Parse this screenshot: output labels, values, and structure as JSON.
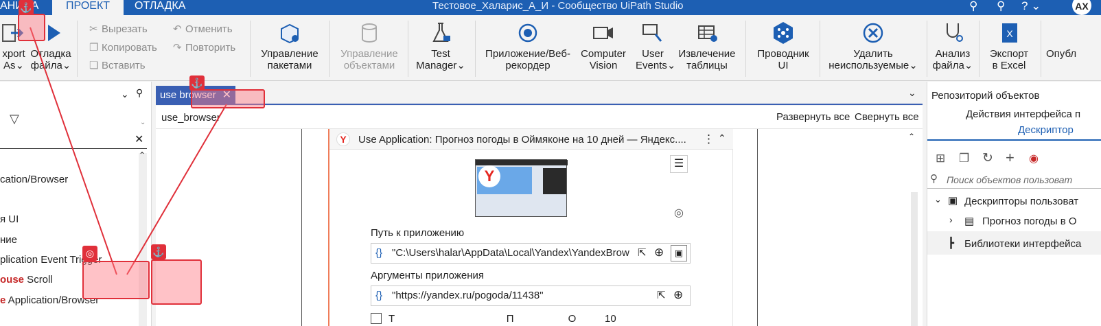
{
  "titlebar": {
    "tabs": [
      "АНИЦА",
      "ПРОЕКТ",
      "ОТЛАДКА"
    ],
    "window_title": "Тестовое_Халарис_А_И - Сообщество UiPath Studio",
    "avatar": "AX",
    "icons": [
      "search-icon",
      "account-icon",
      "help-icon"
    ]
  },
  "ribbon": {
    "export_as": [
      "xport",
      "As"
    ],
    "debug_file": [
      "Отладка",
      "файла"
    ],
    "clipboard": {
      "cut": "Вырезать",
      "copy": "Копировать",
      "paste": "Вставить"
    },
    "history": {
      "undo": "Отменить",
      "redo": "Повторить"
    },
    "manage_packages": [
      "Управление",
      "пакетами"
    ],
    "manage_objects": [
      "Управление",
      "объектами"
    ],
    "test_manager": [
      "Test",
      "Manager"
    ],
    "recorder": [
      "Приложение/Веб-",
      "рекордер"
    ],
    "computer_vision": [
      "Computer",
      "Vision"
    ],
    "user_events": [
      "User",
      "Events"
    ],
    "table_extraction": [
      "Извлечение",
      "таблицы"
    ],
    "ui_explorer": [
      "Проводник",
      "UI"
    ],
    "remove_unused": [
      "Удалить",
      "неиспользуемые"
    ],
    "analyze_file": [
      "Анализ",
      "файла"
    ],
    "export_excel": [
      "Экспорт",
      "в Excel"
    ],
    "publish": "Опубл"
  },
  "left_panel": {
    "items": [
      {
        "pre": "",
        "hl": "",
        "text": "cation/Browser"
      },
      {
        "pre": "",
        "hl": "",
        "text": "я UI"
      },
      {
        "pre": "",
        "hl": "",
        "text": "ние"
      },
      {
        "pre": "",
        "hl": "",
        "text": "plication Event Trigger"
      },
      {
        "pre": "",
        "hl": "ouse",
        "text": " Scroll"
      },
      {
        "pre": "",
        "hl": "e",
        "text": " Application/Browser"
      }
    ]
  },
  "document": {
    "tab_label": "use browser",
    "breadcrumb": "use_browser",
    "expand_all": "Развернуть все",
    "collapse_all": "Свернуть все",
    "activity": {
      "title": "Use Application: Прогноз погоды в Оймяконе на 10 дней — Яндекс....",
      "app_path_label": "Путь к приложению",
      "app_path_value": "\"C:\\Users\\halar\\AppData\\Local\\Yandex\\YandexBrowse",
      "args_label": "Аргументы приложения",
      "args_value": "\"https://yandex.ru/pogoda/11438\"",
      "checkbox_text": "Т                                       П                   О          10"
    }
  },
  "right_panel": {
    "title": "Репозиторий объектов",
    "subtitle": "Действия интерфейса п",
    "tab": "Дескриптор",
    "search_placeholder": "Поиск объектов пользоват",
    "tree": [
      "Дескрипторы пользоват",
      "Прогноз погоды в О",
      "Библиотеки интерфейса"
    ]
  },
  "colors": {
    "accent": "#1d5fb3",
    "tab": "#3a5fb3",
    "overlay": "#e0303a"
  }
}
